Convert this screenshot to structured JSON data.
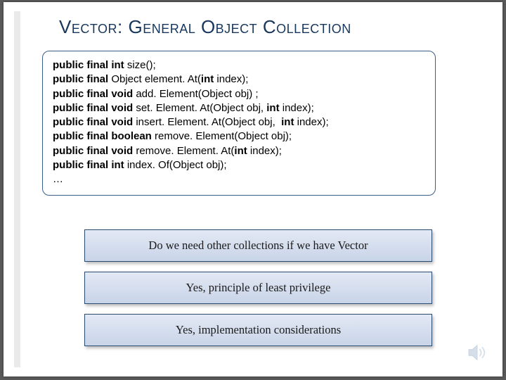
{
  "title": "Vector: General Object Collection",
  "code": {
    "lines": [
      {
        "prefix": "public final int ",
        "name": "size();"
      },
      {
        "prefix": "public final ",
        "mid": "Object ",
        "name": "element. At(",
        "args": "int",
        "tail": " index);"
      },
      {
        "prefix": "public final void ",
        "name": "add. Element(Object obj) ;"
      },
      {
        "prefix": "public final void ",
        "name": "set. Element. At(Object obj, ",
        "args": "int",
        "tail": " index);"
      },
      {
        "prefix": "public final void ",
        "name": "insert. Element. At(Object obj,  ",
        "args": "int",
        "tail": " index);"
      },
      {
        "prefix": "public final boolean ",
        "name": "remove. Element(Object obj);"
      },
      {
        "prefix": "public final void ",
        "name": "remove. Element. At(",
        "args": "int",
        "tail": " index);"
      },
      {
        "prefix": "public final int ",
        "name": "index. Of(Object obj);"
      }
    ],
    "ellipsis": "…"
  },
  "callouts": [
    "Do we need other collections if we have Vector",
    "Yes, principle of least privilege",
    "Yes,  implementation considerations"
  ],
  "icons": {
    "speaker": "speaker-icon"
  }
}
